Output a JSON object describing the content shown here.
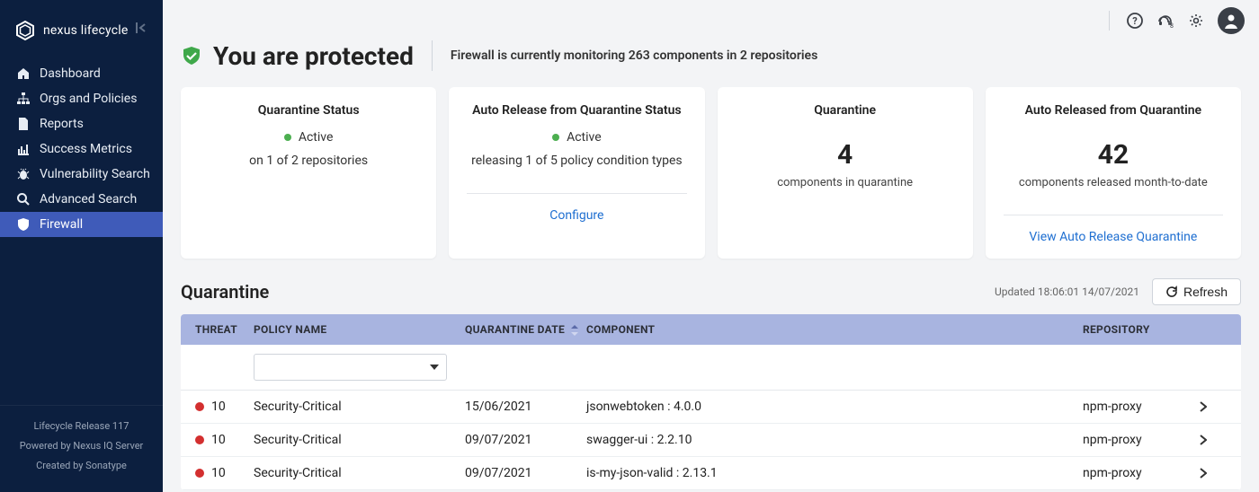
{
  "brand": {
    "name": "nexus lifecycle"
  },
  "sidebar": {
    "items": [
      {
        "label": "Dashboard"
      },
      {
        "label": "Orgs and Policies"
      },
      {
        "label": "Reports"
      },
      {
        "label": "Success Metrics"
      },
      {
        "label": "Vulnerability Search"
      },
      {
        "label": "Advanced Search"
      },
      {
        "label": "Firewall"
      }
    ],
    "footer": {
      "release": "Lifecycle Release 117",
      "powered": "Powered by Nexus IQ Server",
      "created": "Created by Sonatype"
    }
  },
  "hero": {
    "title": "You are protected",
    "subtitle": "Firewall is currently monitoring 263 components in 2 repositories"
  },
  "cards": {
    "quarantine_status": {
      "title": "Quarantine Status",
      "state": "Active",
      "detail": "on 1 of 2 repositories"
    },
    "auto_release_status": {
      "title": "Auto Release from Quarantine Status",
      "state": "Active",
      "detail": "releasing 1 of 5 policy condition types",
      "link": "Configure"
    },
    "quarantine_count": {
      "title": "Quarantine",
      "value": "4",
      "caption": "components in quarantine"
    },
    "auto_released": {
      "title": "Auto Released from Quarantine",
      "value": "42",
      "caption": "components released month-to-date",
      "link": "View Auto Release Quarantine"
    }
  },
  "section": {
    "title": "Quarantine",
    "updated": "Updated 18:06:01 14/07/2021",
    "refresh": "Refresh"
  },
  "table": {
    "headers": {
      "threat": "THREAT",
      "policy": "POLICY NAME",
      "date": "QUARANTINE DATE",
      "component": "COMPONENT",
      "repository": "REPOSITORY"
    },
    "rows": [
      {
        "threat": "10",
        "policy": "Security-Critical",
        "date": "15/06/2021",
        "component": "jsonwebtoken : 4.0.0",
        "repository": "npm-proxy"
      },
      {
        "threat": "10",
        "policy": "Security-Critical",
        "date": "09/07/2021",
        "component": "swagger-ui : 2.2.10",
        "repository": "npm-proxy"
      },
      {
        "threat": "10",
        "policy": "Security-Critical",
        "date": "09/07/2021",
        "component": "is-my-json-valid : 2.13.1",
        "repository": "npm-proxy"
      }
    ]
  }
}
